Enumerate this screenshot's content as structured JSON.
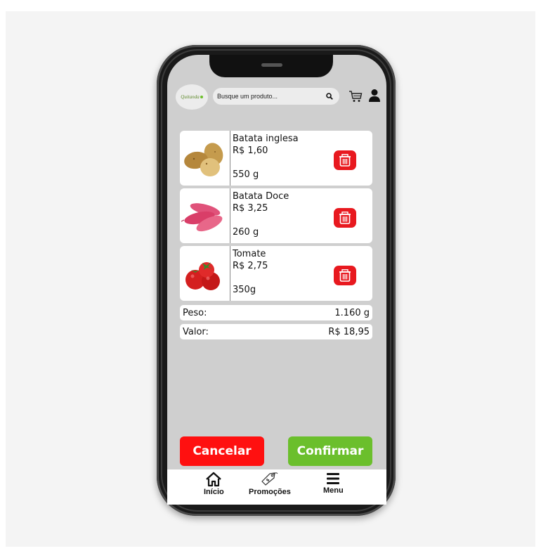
{
  "header": {
    "logo_text": "Quitanda",
    "search": {
      "placeholder": "Busque um produto..."
    },
    "icons": {
      "search": "search-icon",
      "cart": "cart-icon",
      "user": "user-icon"
    }
  },
  "cart": {
    "items": [
      {
        "name": "Batata inglesa",
        "price": "R$ 1,60",
        "weight": "550 g",
        "image": "potato-image"
      },
      {
        "name": "Batata Doce",
        "price": "R$ 3,25",
        "weight": "260 g",
        "image": "sweet-potato-image"
      },
      {
        "name": "Tomate",
        "price": "R$ 2,75",
        "weight": "350g",
        "image": "tomato-image"
      }
    ],
    "summary": {
      "weight_label": "Peso:",
      "weight_value": "1.160 g",
      "value_label": "Valor:",
      "value_value": "R$ 18,95"
    }
  },
  "actions": {
    "cancel_label": "Cancelar",
    "confirm_label": "Confirmar"
  },
  "nav": [
    {
      "label": "Início",
      "icon": "home-icon"
    },
    {
      "label": "Promoções",
      "icon": "tag-icon"
    },
    {
      "label": "Menu",
      "icon": "menu-icon"
    }
  ],
  "colors": {
    "danger": "#e8191f",
    "cancel": "#ff1010",
    "confirm": "#6bbf2c",
    "screen_bg": "#cfcfcf"
  }
}
